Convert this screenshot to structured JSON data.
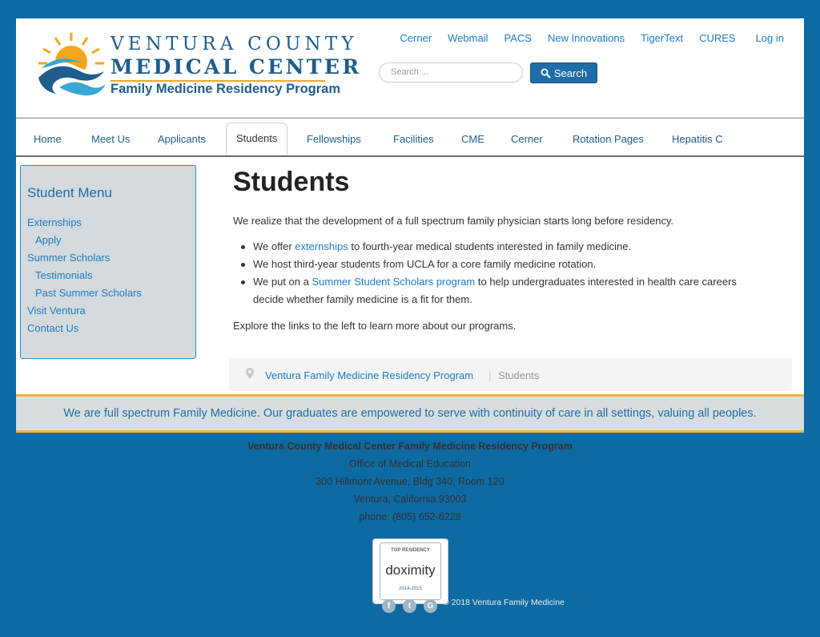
{
  "logo": {
    "line1": "VENTURA COUNTY",
    "line2": "MEDICAL CENTER",
    "line3": "Family Medicine Residency Program"
  },
  "top_links": [
    "Cerner",
    "Webmail",
    "PACS",
    "New Innovations",
    "TigerText",
    "CURES"
  ],
  "login_label": "Log in",
  "search": {
    "placeholder": "Search ...",
    "button_label": "Search"
  },
  "nav": [
    "Home",
    "Meet Us",
    "Applicants",
    "Students",
    "Fellowships",
    "Facilities",
    "CME",
    "Cerner",
    "Rotation Pages",
    "Hepatitis C"
  ],
  "sidebar": {
    "title": "Student Menu",
    "items": [
      "Externships",
      "Apply",
      "Summer Scholars",
      "Testimonials",
      "Past Summer Scholars",
      "Visit Ventura",
      "Contact Us"
    ]
  },
  "main": {
    "title": "Students",
    "intro": "We realize that the development of a full spectrum family physician starts long before residency.",
    "bullet1_pre": "We offer ",
    "bullet1_link": "externships",
    "bullet1_post": " to fourth-year medical students interested in family medicine.",
    "bullet2": "We host third-year students from UCLA for a core family medicine rotation.",
    "bullet3_pre": "We put on a ",
    "bullet3_link": "Summer Student Scholars program",
    "bullet3_post": " to help undergraduates interested in health care careers",
    "bullet3_line2": "decide whether family medicine is a fit for them.",
    "outro": "Explore the links to the left to learn more about our programs."
  },
  "breadcrumb": {
    "home": "Ventura Family Medicine Residency Program",
    "separator": "|",
    "current": "Students"
  },
  "mission": "We are full spectrum Family Medicine. Our graduates are empowered to serve with continuity of care in all settings, valuing all peoples.",
  "footer": {
    "org": "Ventura County Medical Center Family Medicine Residency Program",
    "office": "Office of Medical Education",
    "address": "300 Hillmont Avenue, Bldg 340, Room 120",
    "city": "Ventura, California 93003",
    "phone": "phone: (805) 652-6228",
    "badge_top": "TOP RESIDENCY",
    "badge_name": "doximity",
    "badge_years": "2014-2015",
    "copyright": "© 2018 Ventura Family Medicine"
  },
  "colors": {
    "page_bg": "#0e6aa2",
    "link": "#1d7cc3",
    "accent": "#f0b43a"
  }
}
